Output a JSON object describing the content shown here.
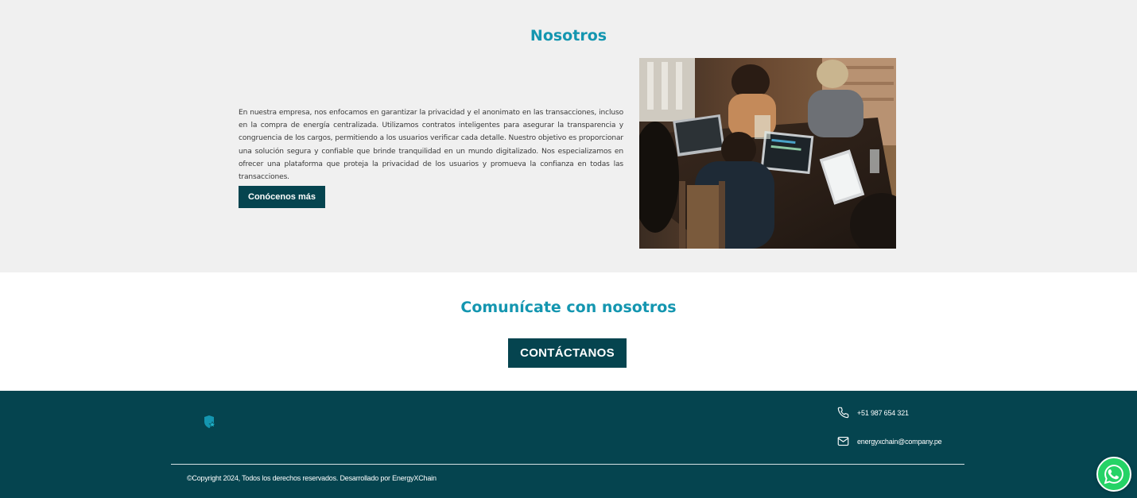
{
  "about": {
    "title": "Nosotros",
    "text": "En nuestra empresa, nos enfocamos en garantizar la privacidad y el anonimato en las transacciones, incluso en la compra de energía centralizada. Utilizamos contratos inteligentes para asegurar la transparencia y congruencia de los cargos, permitiendo a los usuarios verificar cada detalle. Nuestro objetivo es proporcionar una solución segura y confiable que brinde tranquilidad en un mundo digitalizado. Nos especializamos en ofrecer una plataforma que proteja la privacidad de los usuarios y promueva la confianza en todas las transacciones.",
    "button_label": "Conócenos más"
  },
  "contact": {
    "title": "Comunícate con nosotros",
    "button_label": "CONTÁCTANOS"
  },
  "footer": {
    "phone": "+51 987 654 321",
    "email": "energyxchain@company.pe",
    "copyright": "©Copyright 2024, Todos los derechos reservados. Desarrollado por EnergyXChain"
  },
  "icons": {
    "logo": "shield-logo-icon",
    "phone": "phone-icon",
    "email": "mail-icon",
    "whatsapp": "whatsapp-icon"
  },
  "colors": {
    "accent_teal": "#1496b0",
    "dark_teal": "#05444f",
    "about_bg": "#f0f0f0",
    "whatsapp_green": "#25d366"
  }
}
